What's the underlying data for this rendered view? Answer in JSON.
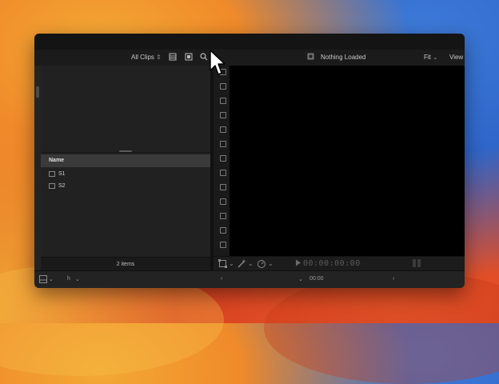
{
  "toolbar": {
    "clips_filter": "All Clips",
    "viewer_title": "Nothing Loaded",
    "zoom": "Fit",
    "view_menu": "View"
  },
  "browser": {
    "column_name": "Name",
    "clips": [
      {
        "label": "S1"
      },
      {
        "label": "S2"
      }
    ],
    "footer_count": "2 items"
  },
  "viewer": {
    "timecode": "00:00:00:00"
  },
  "bottom": {
    "h_label": "h",
    "time": "00:00"
  },
  "icons": {
    "filmstrip_toggle": "filmstrip-icon",
    "clip_appearance": "clip-appearance-icon",
    "search": "search-icon",
    "nothing_loaded": "viewer-empty-icon",
    "transform": "transform-icon",
    "enhance": "magic-wand-icon",
    "speed": "speed-icon",
    "play": "play-icon"
  }
}
